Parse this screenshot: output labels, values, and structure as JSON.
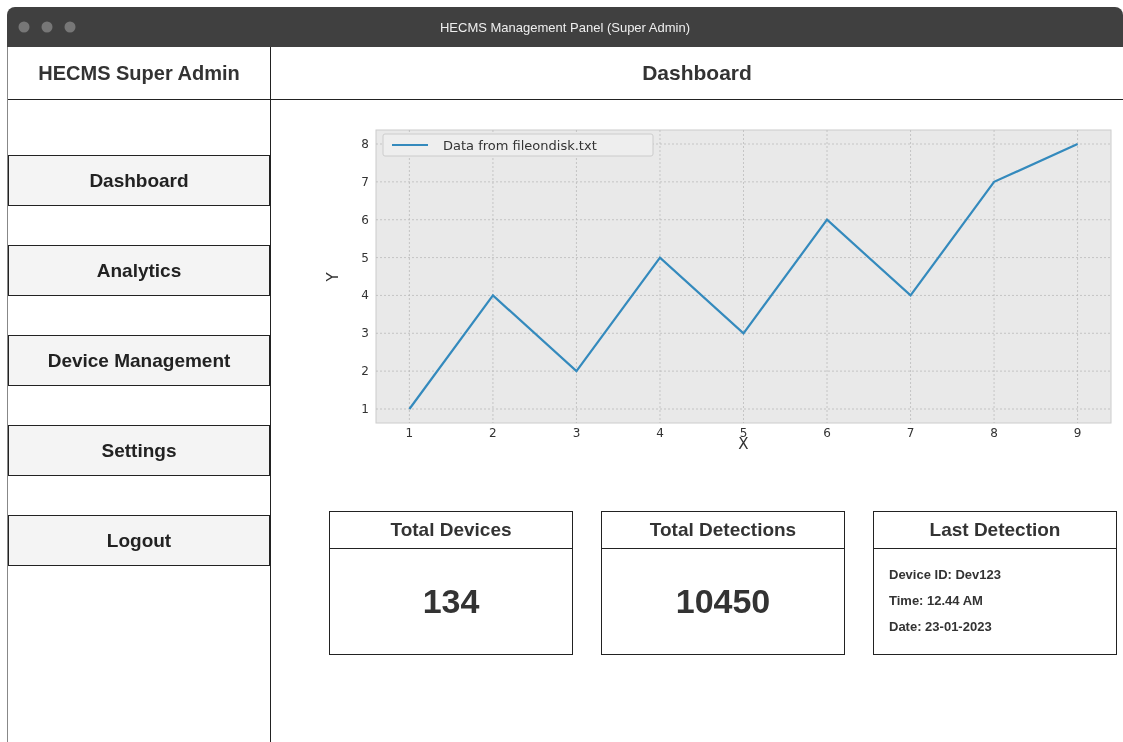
{
  "window": {
    "title": "HECMS Management Panel (Super Admin)"
  },
  "sidebar": {
    "title": "HECMS Super Admin",
    "items": [
      {
        "label": "Dashboard"
      },
      {
        "label": "Analytics"
      },
      {
        "label": "Device Management"
      },
      {
        "label": "Settings"
      },
      {
        "label": "Logout"
      }
    ]
  },
  "header": {
    "title": "Dashboard"
  },
  "chart": {
    "chart_data": {
      "type": "line",
      "xlabel": "X",
      "ylabel": "Y",
      "x": [
        1,
        2,
        3,
        4,
        5,
        6,
        7,
        8,
        9
      ],
      "series": [
        {
          "name": "Data from fileondisk.txt",
          "color": "#348abd",
          "values": [
            1,
            4,
            2,
            5,
            3,
            6,
            4,
            7,
            8
          ]
        }
      ],
      "xlim": [
        0.6,
        9.4
      ],
      "ylim": [
        0.63,
        8.37
      ],
      "xticks": [
        1,
        2,
        3,
        4,
        5,
        6,
        7,
        8,
        9
      ],
      "yticks": [
        1,
        2,
        3,
        4,
        5,
        6,
        7,
        8
      ],
      "grid": true
    }
  },
  "cards": [
    {
      "kind": "number",
      "title": "Total Devices",
      "value": "134"
    },
    {
      "kind": "number",
      "title": "Total Detections",
      "value": "10450"
    },
    {
      "kind": "details",
      "title": "Last Detection",
      "lines": [
        "Device ID: Dev123",
        "Time: 12.44 AM",
        "Date: 23-01-2023"
      ]
    }
  ]
}
